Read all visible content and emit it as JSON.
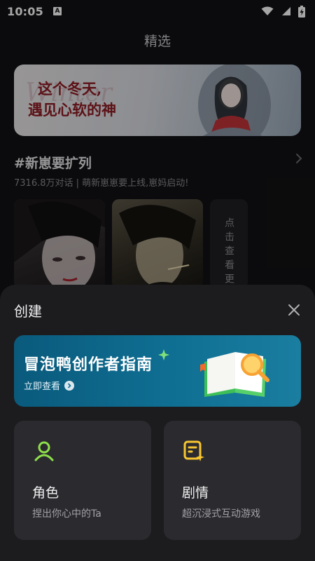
{
  "status_bar": {
    "time": "10:05",
    "notification_letter": "A"
  },
  "page": {
    "title": "精选"
  },
  "banner": {
    "script_text": "Winter",
    "line1": "这个冬天,",
    "line2": "遇见心软的神"
  },
  "section": {
    "title": "#新崽要扩列",
    "subtitle": "7316.8万对话 | 萌新崽崽要上线,崽妈启动!",
    "more_label": "点击查看更"
  },
  "sheet": {
    "title": "创建",
    "guide": {
      "title": "冒泡鸭创作者指南",
      "link_label": "立即查看"
    },
    "options": [
      {
        "title": "角色",
        "desc": "捏出你心中的Ta",
        "icon": "person-icon"
      },
      {
        "title": "剧情",
        "desc": "超沉浸式互动游戏",
        "icon": "story-icon"
      }
    ]
  },
  "colors": {
    "accent_green": "#8ee04a",
    "accent_yellow": "#f7c531",
    "sheet_bg": "#1c1c1f",
    "card_bg": "#2b2b2f",
    "guide_bg": "#0f6f93"
  }
}
